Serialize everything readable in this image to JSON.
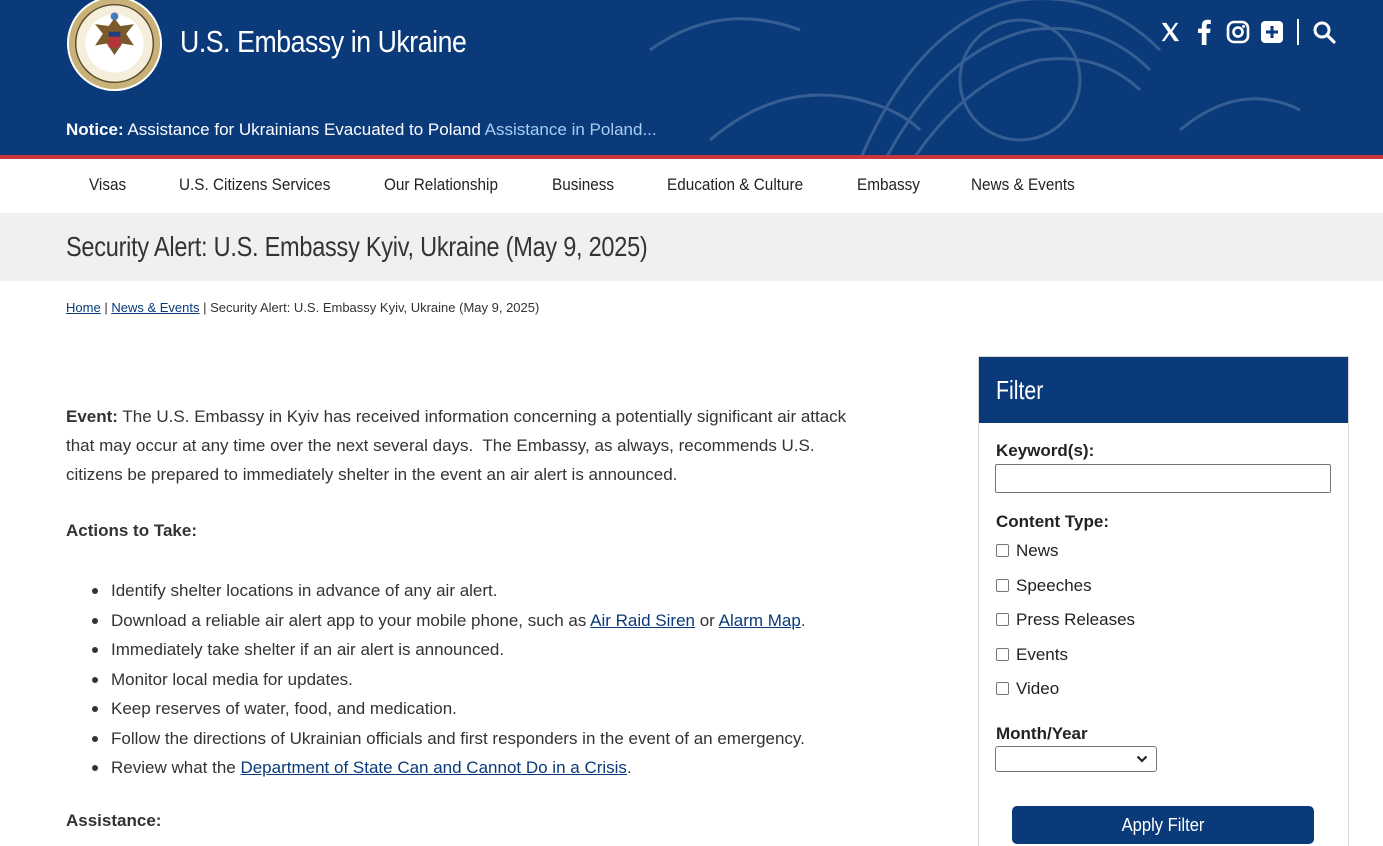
{
  "header": {
    "site_title": "U.S. Embassy in Ukraine",
    "notice_label": "Notice:",
    "notice_text": "Assistance for Ukrainians Evacuated to Poland",
    "notice_link": "Assistance in Poland...",
    "social_icons": [
      "x-icon",
      "facebook-icon",
      "instagram-icon",
      "flickr-icon",
      "search-icon"
    ]
  },
  "nav": {
    "items": [
      "Visas",
      "U.S. Citizens Services",
      "Our Relationship",
      "Business",
      "Education & Culture",
      "Embassy",
      "News & Events"
    ]
  },
  "page": {
    "title": "Security Alert: U.S. Embassy Kyiv, Ukraine (May 9, 2025)"
  },
  "breadcrumb": {
    "home": "Home",
    "sep": "|",
    "section": "News & Events",
    "current": "Security Alert: U.S. Embassy Kyiv, Ukraine (May 9, 2025)"
  },
  "article": {
    "event_label": "Event:",
    "event_line1": "The U.S. Embassy in Kyiv has received information concerning a potentially significant air attack",
    "event_line2": "that may occur at any time over the next several days.  The Embassy, as always, recommends U.S.",
    "event_line3": "citizens be prepared to immediately shelter in the event an air alert is announced.",
    "actions_heading": "Actions to Take:",
    "bullets": {
      "b1": "Identify shelter locations in advance of any air alert.",
      "b2_pre": "Download a reliable air alert app to your mobile phone, such as ",
      "b2_link1": "Air Raid Siren",
      "b2_mid": " or ",
      "b2_link2": "Alarm Map",
      "b2_post": ".",
      "b3": "Immediately take shelter if an air alert is announced.",
      "b4": "Monitor local media for updates.",
      "b5": "Keep reserves of water, food, and medication.",
      "b6": "Follow the directions of Ukrainian officials and first responders in the event of an emergency.",
      "b7_pre": "Review what the ",
      "b7_link": "Department of State Can and Cannot Do in a Crisis",
      "b7_post": "."
    },
    "assistance_heading": "Assistance:"
  },
  "filter": {
    "title": "Filter",
    "keyword_label": "Keyword(s):",
    "keyword_value": "",
    "content_type_label": "Content Type:",
    "content_types": [
      "News",
      "Speeches",
      "Press Releases",
      "Events",
      "Video"
    ],
    "month_label": "Month/Year",
    "month_value": "",
    "apply_label": "Apply Filter"
  },
  "colors": {
    "brand_blue": "#0a3a7a",
    "accent_red": "#c9363c",
    "link_light": "#a8ccf5"
  }
}
